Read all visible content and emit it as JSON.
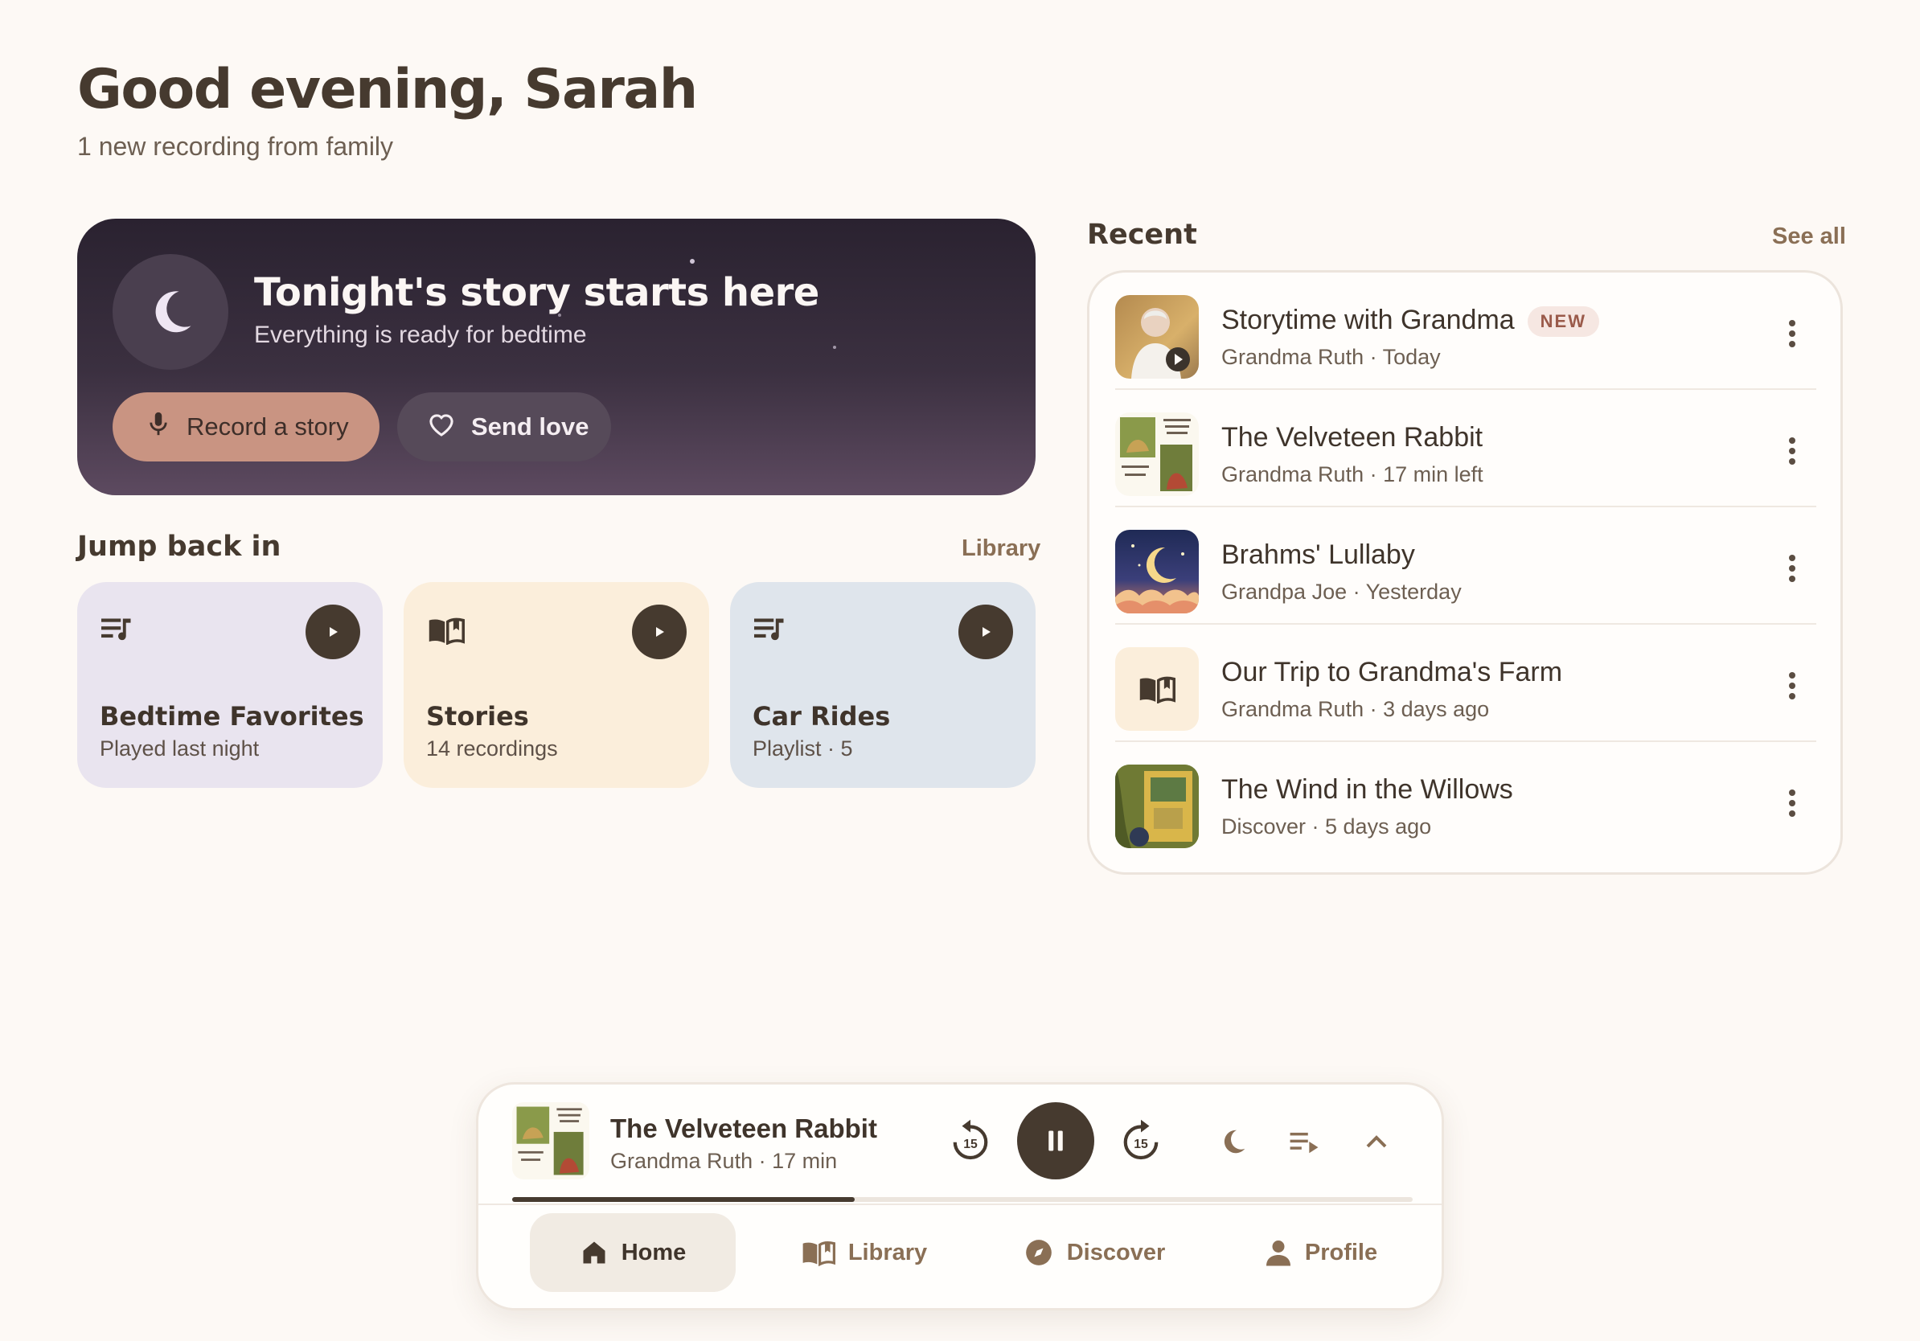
{
  "header": {
    "greeting": "Good evening, Sarah",
    "subtitle": "1 new recording from family"
  },
  "hero": {
    "title": "Tonight's story starts here",
    "subtitle": "Everything is ready for bedtime",
    "record_label": "Record a story",
    "love_label": "Send love",
    "icon": "moon-icon"
  },
  "jump": {
    "title": "Jump back in",
    "link": "Library",
    "cards": [
      {
        "title": "Bedtime Favorites",
        "sub": "Played last night",
        "icon": "playlist-icon",
        "color": "#e9e4ef"
      },
      {
        "title": "Stories",
        "sub": "14 recordings",
        "icon": "book-icon",
        "color": "#fbeedb"
      },
      {
        "title": "Car Rides",
        "sub": "Playlist · 5",
        "icon": "playlist-icon",
        "color": "#dfe5ec"
      }
    ]
  },
  "recent": {
    "title": "Recent",
    "link": "See all",
    "new_badge": "NEW",
    "items": [
      {
        "title": "Storytime with Grandma",
        "sub": "Grandma Ruth · Today",
        "is_new": true
      },
      {
        "title": "The Velveteen Rabbit",
        "sub": "Grandma Ruth · 17 min left"
      },
      {
        "title": "Brahms' Lullaby",
        "sub": "Grandpa Joe · Yesterday"
      },
      {
        "title": "Our Trip to Grandma's Farm",
        "sub": "Grandma Ruth · 3 days ago"
      },
      {
        "title": "The Wind in the Willows",
        "sub": "Discover · 5 days ago"
      }
    ]
  },
  "player": {
    "title": "The Velveteen Rabbit",
    "sub": "Grandma Ruth · 17 min",
    "skip_back": "15",
    "skip_forward": "15",
    "progress": 0.38
  },
  "nav": {
    "home": "Home",
    "library": "Library",
    "discover": "Discover",
    "profile": "Profile",
    "active": "home"
  },
  "colors": {
    "accent": "#463a2f",
    "record_button": "#c99482",
    "link": "#8a6f55",
    "background": "#fdf9f5"
  }
}
